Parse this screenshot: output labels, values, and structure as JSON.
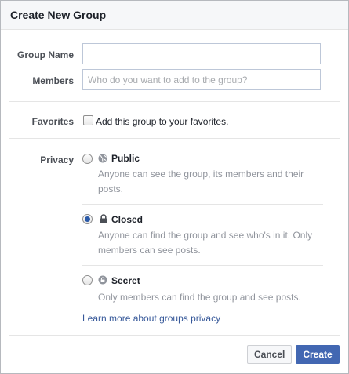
{
  "dialog": {
    "title": "Create New Group"
  },
  "form": {
    "group_name": {
      "label": "Group Name",
      "value": "",
      "placeholder": ""
    },
    "members": {
      "label": "Members",
      "value": "",
      "placeholder": "Who do you want to add to the group?"
    },
    "favorites": {
      "label": "Favorites",
      "checkbox_label": "Add this group to your favorites.",
      "checked": false
    },
    "privacy": {
      "label": "Privacy",
      "selected": "Closed",
      "options": [
        {
          "title": "Public",
          "icon": "globe-icon",
          "description": "Anyone can see the group, its members and their posts."
        },
        {
          "title": "Closed",
          "icon": "lock-icon",
          "description": "Anyone can find the group and see who's in it. Only members can see posts."
        },
        {
          "title": "Secret",
          "icon": "secret-lock-icon",
          "description": "Only members can find the group and see posts."
        }
      ],
      "learn_more_link": "Learn more about groups privacy"
    }
  },
  "footer": {
    "cancel_label": "Cancel",
    "create_label": "Create"
  },
  "colors": {
    "primary_button": "#4267b2",
    "link": "#365899",
    "radio_selected": "#2b5aa8"
  }
}
